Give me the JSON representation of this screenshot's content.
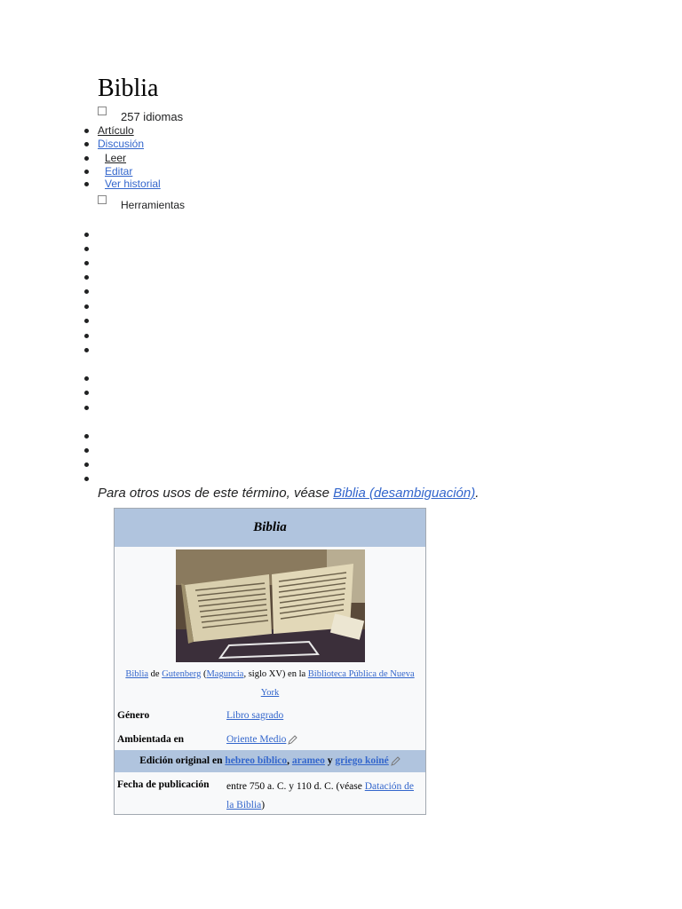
{
  "page": {
    "title": "Biblia"
  },
  "languages": {
    "label": "257 idiomas"
  },
  "namespaces": [
    {
      "label": "Artículo"
    },
    {
      "label": "Discusión"
    }
  ],
  "views": [
    {
      "label": "Leer"
    },
    {
      "label": "Editar"
    },
    {
      "label": "Ver historial"
    }
  ],
  "tools": {
    "label": "Herramientas"
  },
  "hatnote": {
    "prefix": "Para otros usos de este término, véase ",
    "link": "Biblia (desambiguación)",
    "suffix": "."
  },
  "infobox": {
    "title": "Biblia",
    "caption": {
      "link1": "Biblia",
      "text1": " de ",
      "link2": "Gutenberg",
      "text2": " (",
      "link3": "Maguncia",
      "text3": ", siglo XV) en la ",
      "link4": "Biblioteca Pública de Nueva York"
    },
    "rows": [
      {
        "label": "Género",
        "value_link": "Libro sagrado"
      },
      {
        "label": "Ambientada en",
        "value_link": "Oriente Medio"
      }
    ],
    "original_edition": {
      "prefix": "Edición original en ",
      "lang1": "hebreo bíblico",
      "sep1": ", ",
      "lang2": "arameo",
      "sep2": " y ",
      "lang3": "griego koiné"
    },
    "publication": {
      "label": "Fecha de publicación",
      "text": "entre 750 a. C. y 110 d. C. (véase ",
      "link": "Datación de la Biblia",
      "suffix": ")"
    }
  },
  "colors": {
    "link": "#3366cc",
    "infobox_header": "#b0c4de",
    "infobox_bg": "#f8f9fa",
    "infobox_border": "#a2a9b1"
  }
}
